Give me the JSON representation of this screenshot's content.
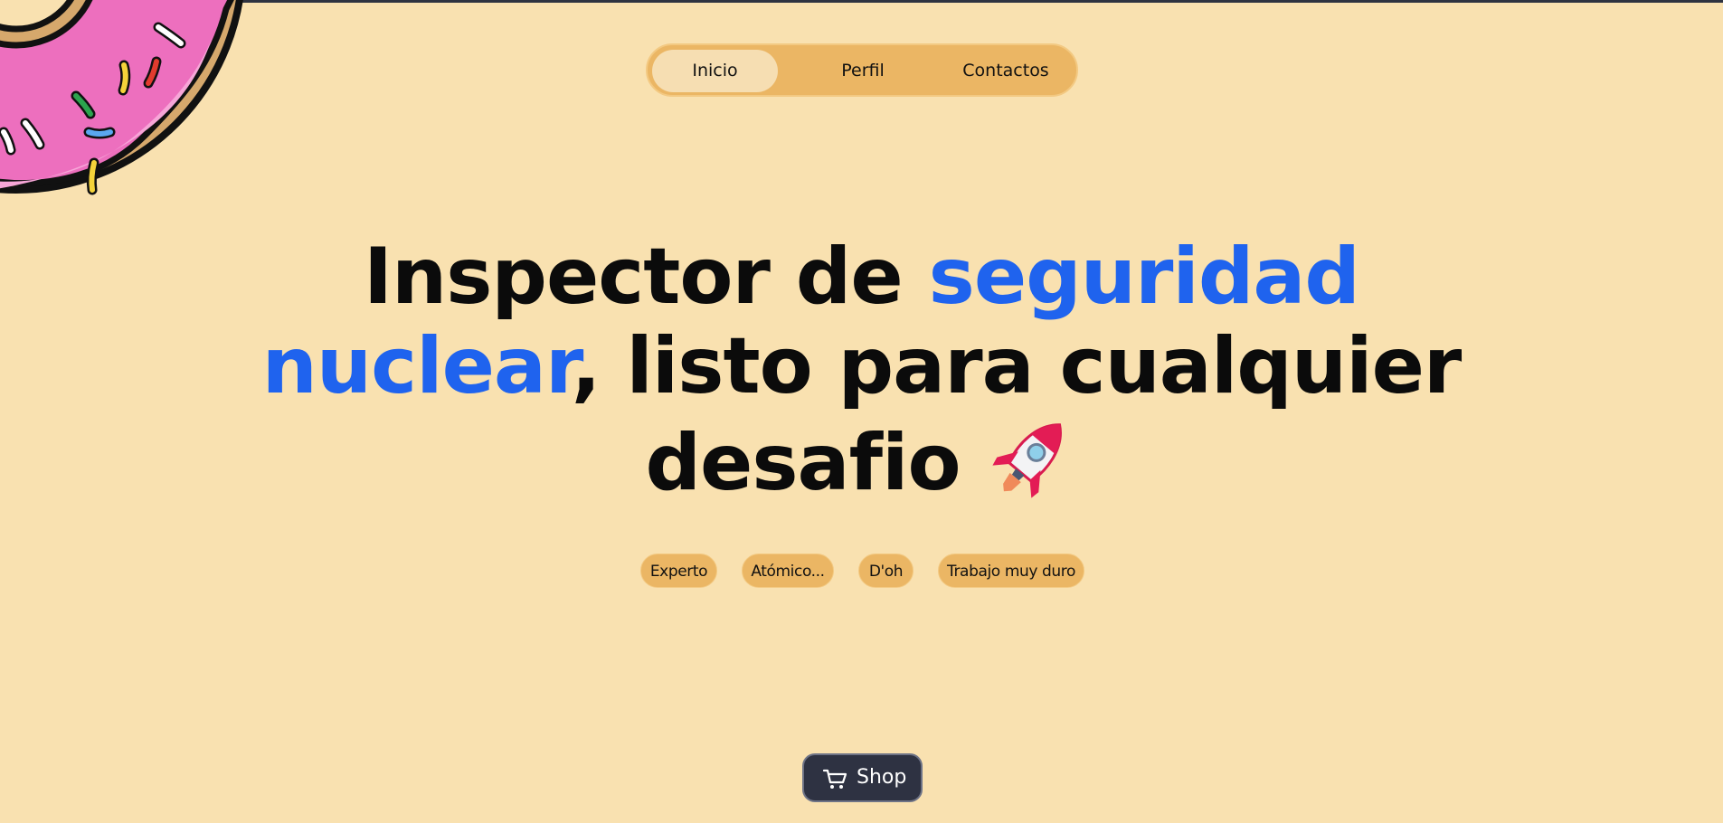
{
  "nav": {
    "items": [
      {
        "label": "Inicio",
        "active": true
      },
      {
        "label": "Perfil",
        "active": false
      },
      {
        "label": "Contactos",
        "active": false
      }
    ]
  },
  "hero": {
    "headline_part1": "Inspector de ",
    "headline_highlight1": "seguridad",
    "headline_highlight2": "nuclear",
    "headline_part2": ", listo para cualquier",
    "headline_part3": "desafio",
    "emoji_icon": "rocket-icon",
    "highlight_color": "#1f63ee"
  },
  "tags": [
    "Experto",
    "Atómico...",
    "D'oh",
    "Trabajo muy duro"
  ],
  "shop_button": {
    "label": "Shop",
    "icon": "cart-icon"
  },
  "decoration": {
    "icon": "donut-icon"
  },
  "colors": {
    "background": "#f9e1b0",
    "accent": "#ebb664",
    "active_tab": "#f6deb2",
    "button_dark": "#2e3242"
  }
}
